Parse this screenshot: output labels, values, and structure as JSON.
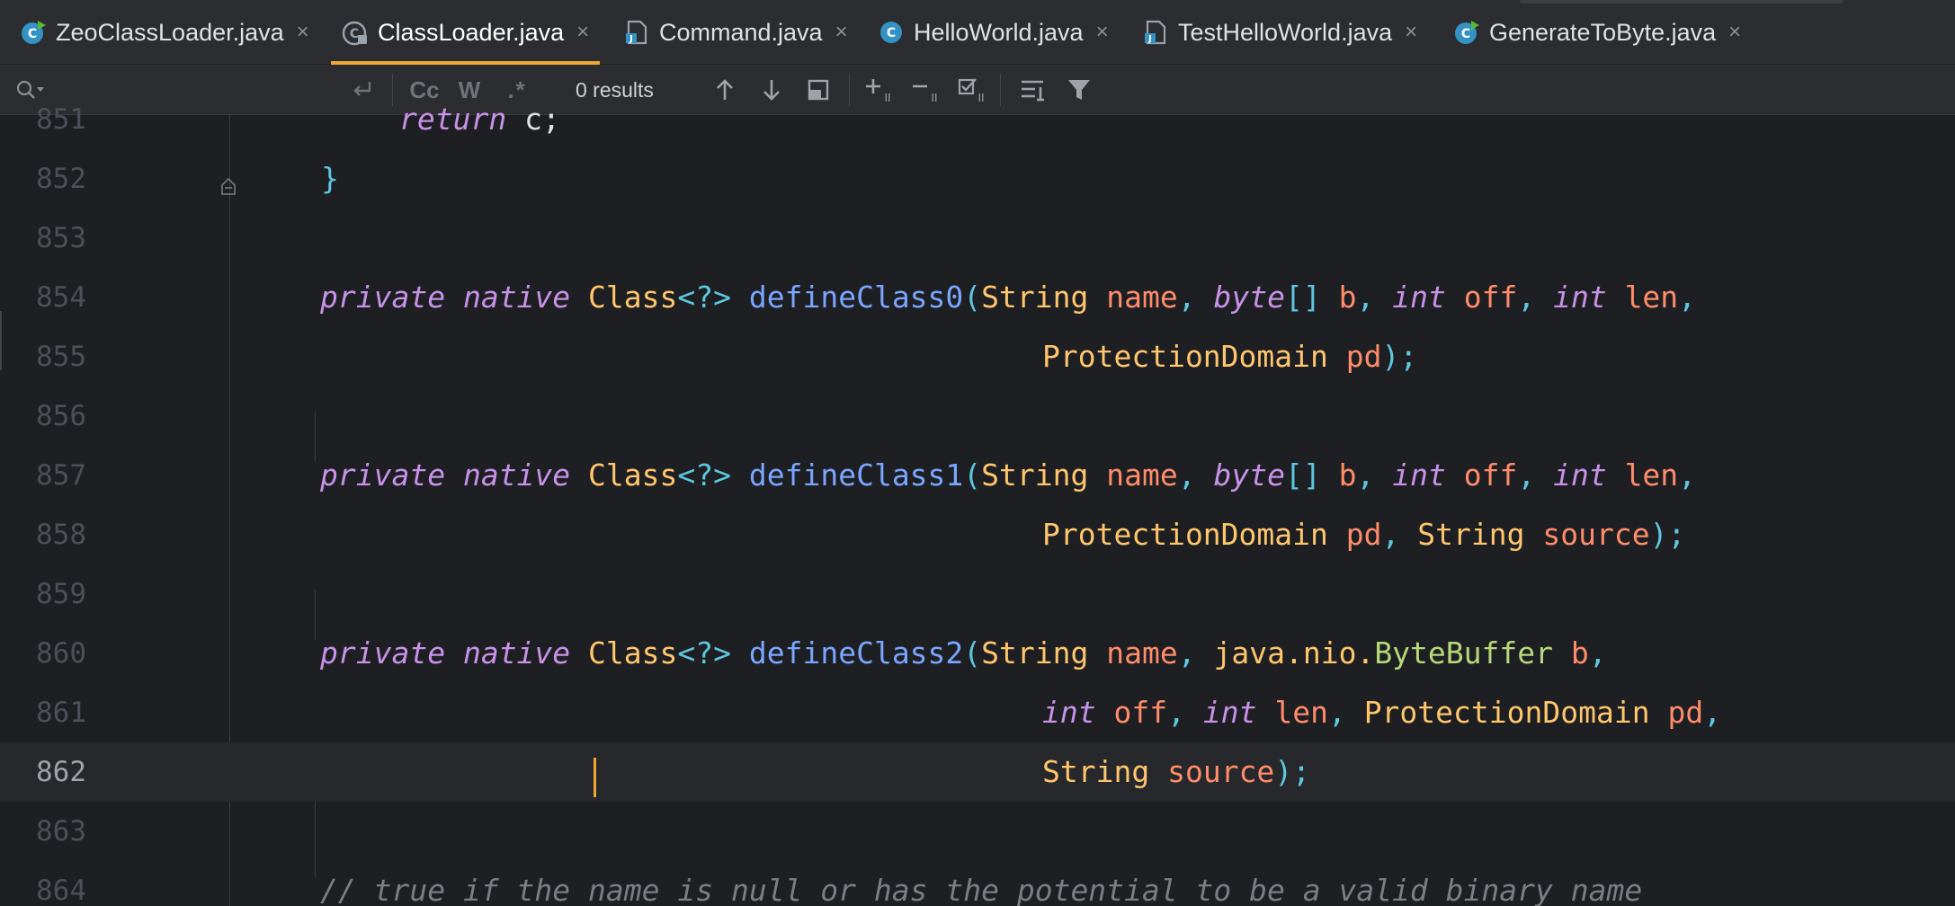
{
  "tabs": [
    {
      "label": "ZeoClassLoader.java",
      "icon": "java-class-run-icon",
      "active": false
    },
    {
      "label": "ClassLoader.java",
      "icon": "java-class-readonly-icon",
      "active": true
    },
    {
      "label": "Command.java",
      "icon": "java-file-icon",
      "active": false
    },
    {
      "label": "HelloWorld.java",
      "icon": "java-class-icon",
      "active": false
    },
    {
      "label": "TestHelloWorld.java",
      "icon": "java-file-icon",
      "active": false
    },
    {
      "label": "GenerateToByte.java",
      "icon": "java-class-run-icon",
      "active": false
    }
  ],
  "close_glyph": "×",
  "search": {
    "placeholder": "",
    "results": "0 results",
    "match_case": "Cc",
    "words": "W",
    "regex": ".*"
  },
  "editor": {
    "current_line": "862",
    "lines": [
      {
        "n": "851"
      },
      {
        "n": "852"
      },
      {
        "n": "853"
      },
      {
        "n": "854"
      },
      {
        "n": "855"
      },
      {
        "n": "856"
      },
      {
        "n": "857"
      },
      {
        "n": "858"
      },
      {
        "n": "859"
      },
      {
        "n": "860"
      },
      {
        "n": "861"
      },
      {
        "n": "862"
      },
      {
        "n": "863"
      },
      {
        "n": "864"
      }
    ],
    "code": {
      "l851": [
        "return",
        "c;"
      ],
      "l852": [
        "}"
      ],
      "l854": [
        "private",
        "native",
        "Class",
        "<?>",
        "defineClass0",
        "(",
        "String",
        "name",
        ",",
        "byte",
        "[]",
        "b",
        ",",
        "int",
        "off",
        ",",
        "int",
        "len",
        ","
      ],
      "l855": [
        "ProtectionDomain",
        "pd",
        ");"
      ],
      "l857": [
        "private",
        "native",
        "Class",
        "<?>",
        "defineClass1",
        "(",
        "String",
        "name",
        ",",
        "byte",
        "[]",
        "b",
        ",",
        "int",
        "off",
        ",",
        "int",
        "len",
        ","
      ],
      "l858": [
        "ProtectionDomain",
        "pd",
        ",",
        "String",
        "source",
        ");"
      ],
      "l860": [
        "private",
        "native",
        "Class",
        "<?>",
        "defineClass2",
        "(",
        "String",
        "name",
        ",",
        "java.nio.",
        "ByteBuffer",
        "b",
        ","
      ],
      "l861": [
        "int",
        "off",
        ",",
        "int",
        "len",
        ",",
        "ProtectionDomain",
        "pd",
        ","
      ],
      "l862": [
        "String",
        "source",
        ");"
      ],
      "l864": [
        "// true if the name is null or has the potential to be a valid binary name"
      ]
    }
  },
  "colors": {
    "accent": "#f0a732",
    "keyword": "#c892e8",
    "type": "#ffc66d",
    "function": "#7aa6ff",
    "parameter": "#ff8c6b",
    "punctuation": "#5ec8e0"
  }
}
